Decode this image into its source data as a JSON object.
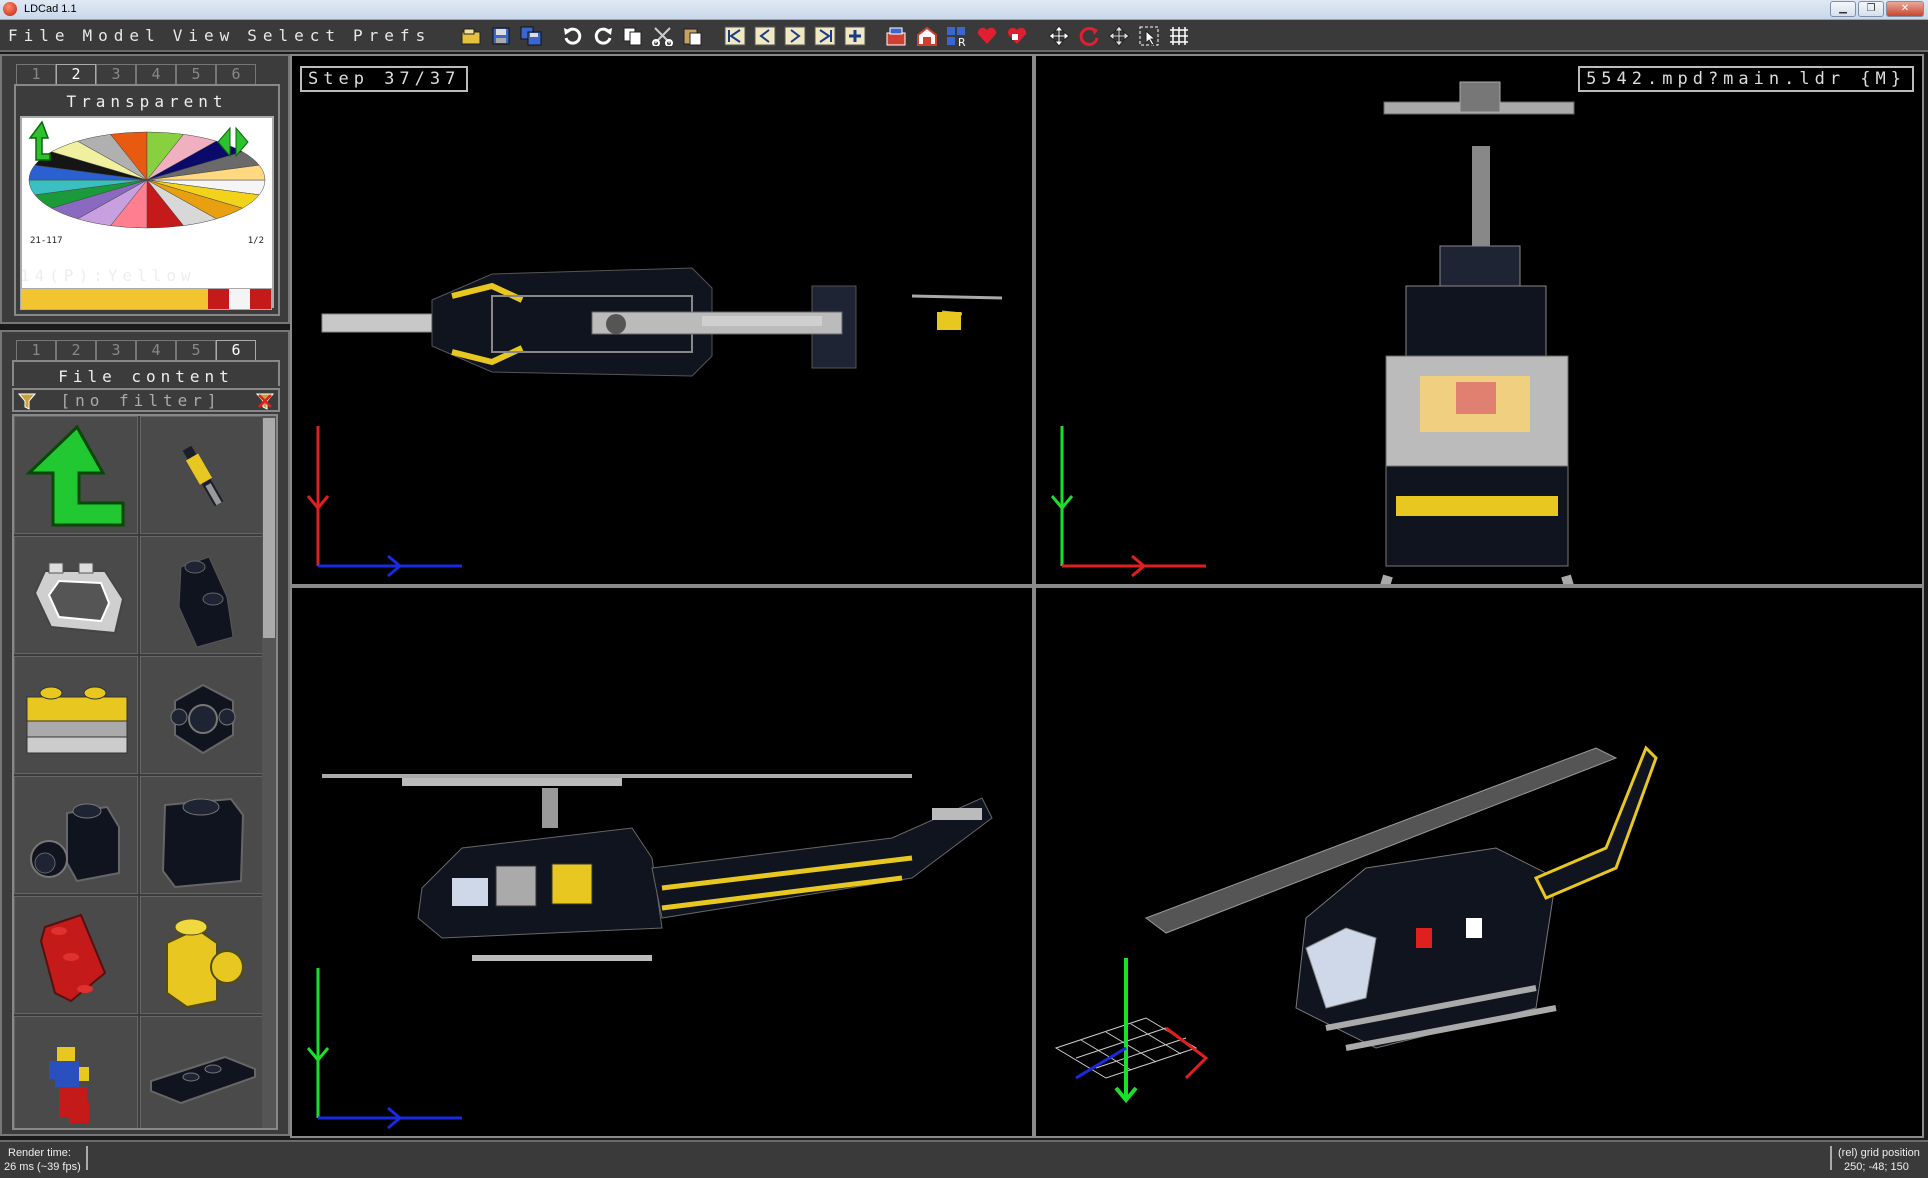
{
  "window": {
    "title": "LDCad 1.1",
    "minimize": "▁",
    "maximize": "❐",
    "close": "✕"
  },
  "menu": [
    "File",
    "Model",
    "View",
    "Select",
    "Prefs"
  ],
  "toolbar_icons": [
    "open-file-icon",
    "save-icon",
    "save-all-icon",
    "undo-icon",
    "redo-icon",
    "copy-icon",
    "cut-icon",
    "paste-icon",
    "first-step-icon",
    "prev-step-icon",
    "next-step-icon",
    "last-step-icon",
    "add-step-icon",
    "part-bin-icon",
    "submodel-icon",
    "rotate-mode-icon",
    "heart-icon",
    "heart-remove-icon",
    "move-icon",
    "rotate-icon",
    "drag-icon",
    "select-icon",
    "grid-icon"
  ],
  "color_panel": {
    "tabs": [
      "1",
      "2",
      "3",
      "4",
      "5",
      "6"
    ],
    "active_tab": 1,
    "title": "Transparent",
    "range_label": "21-117",
    "page_label": "1/2",
    "selected_color_label": "14(P):Yellow",
    "swatches": [
      "#f2c530",
      "#f2c530",
      "#f2c530",
      "#f2c530",
      "#f2c530",
      "#f2c530",
      "#f2c530",
      "#f2c530",
      "#f2c530",
      "#c41a1a",
      "#f4f4f4",
      "#c41a1a"
    ],
    "pie_colors": [
      "#f5f5f5",
      "#f2d21a",
      "#e8a010",
      "#d8d8d8",
      "#c41a1a",
      "#ff7f90",
      "#c8a0e0",
      "#8a6ac0",
      "#1a9a3a",
      "#3ac0c0",
      "#2a60d0",
      "#151515",
      "#f0f0a0",
      "#b0b0b0",
      "#e85a10",
      "#88d040",
      "#f0b0c0",
      "#0a0a6a",
      "#6a6a6a",
      "#ffd880"
    ]
  },
  "parts_panel": {
    "tabs": [
      "1",
      "2",
      "3",
      "4",
      "5",
      "6"
    ],
    "active_tab": 5,
    "title": "File content",
    "filter_text": "[no filter]",
    "items": [
      "up-folder",
      "helicopter-submodel",
      "windscreen-part",
      "slope-brick-part",
      "yellow-bricks-part",
      "round-connector-part",
      "black-brick-round-part",
      "black-brick-part",
      "red-plate-part",
      "yellow-round-part",
      "minifig-part",
      "black-plate-part"
    ]
  },
  "viewports": {
    "top_left": {
      "label": "Step 37/37"
    },
    "top_right": {
      "label": "5542.mpd?main.ldr {M}"
    }
  },
  "status": {
    "render_label": "Render time:",
    "render_value": "26 ms (~39 fps)",
    "grid_label": "(rel) grid position",
    "grid_value": "250; -48; 150"
  }
}
